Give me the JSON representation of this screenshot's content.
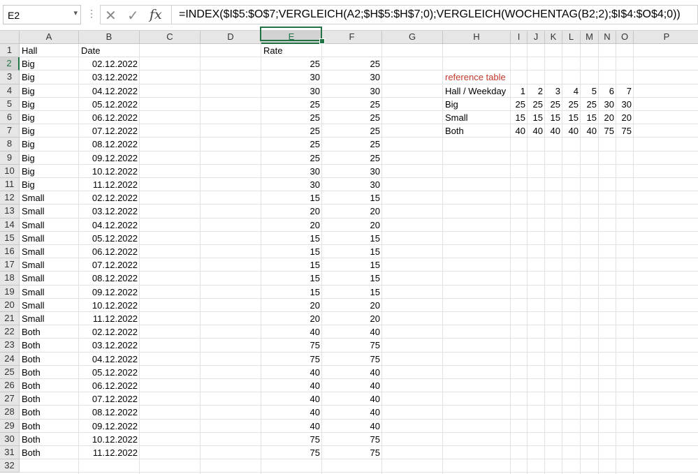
{
  "name_box": {
    "value": "E2"
  },
  "formula_bar": {
    "cancel_icon": "close-icon",
    "enter_icon": "check-icon",
    "fx_label": "fx",
    "formula": "=INDEX($I$5:$O$7;VERGLEICH(A2;$H$5:$H$7;0);VERGLEICH(WOCHENTAG(B2;2);$I$4:$O$4;0))"
  },
  "columns": [
    "A",
    "B",
    "C",
    "D",
    "E",
    "F",
    "G",
    "H",
    "I",
    "J",
    "K",
    "L",
    "M",
    "N",
    "O",
    "P"
  ],
  "active_column": "E",
  "active_row": 2,
  "row_numbers": [
    1,
    2,
    3,
    4,
    5,
    6,
    7,
    8,
    9,
    10,
    11,
    12,
    13,
    14,
    15,
    16,
    17,
    18,
    19,
    20,
    21,
    22,
    23,
    24,
    25,
    26,
    27,
    28,
    29,
    30,
    31,
    32
  ],
  "headers": {
    "A1": "Hall",
    "B1": "Date",
    "E1": "Rate"
  },
  "data_rows": [
    {
      "hall": "Big",
      "date": "02.12.2022",
      "rate": "25",
      "f": "25"
    },
    {
      "hall": "Big",
      "date": "03.12.2022",
      "rate": "30",
      "f": "30"
    },
    {
      "hall": "Big",
      "date": "04.12.2022",
      "rate": "30",
      "f": "30"
    },
    {
      "hall": "Big",
      "date": "05.12.2022",
      "rate": "25",
      "f": "25"
    },
    {
      "hall": "Big",
      "date": "06.12.2022",
      "rate": "25",
      "f": "25"
    },
    {
      "hall": "Big",
      "date": "07.12.2022",
      "rate": "25",
      "f": "25"
    },
    {
      "hall": "Big",
      "date": "08.12.2022",
      "rate": "25",
      "f": "25"
    },
    {
      "hall": "Big",
      "date": "09.12.2022",
      "rate": "25",
      "f": "25"
    },
    {
      "hall": "Big",
      "date": "10.12.2022",
      "rate": "30",
      "f": "30"
    },
    {
      "hall": "Big",
      "date": "11.12.2022",
      "rate": "30",
      "f": "30"
    },
    {
      "hall": "Small",
      "date": "02.12.2022",
      "rate": "15",
      "f": "15"
    },
    {
      "hall": "Small",
      "date": "03.12.2022",
      "rate": "20",
      "f": "20"
    },
    {
      "hall": "Small",
      "date": "04.12.2022",
      "rate": "20",
      "f": "20"
    },
    {
      "hall": "Small",
      "date": "05.12.2022",
      "rate": "15",
      "f": "15"
    },
    {
      "hall": "Small",
      "date": "06.12.2022",
      "rate": "15",
      "f": "15"
    },
    {
      "hall": "Small",
      "date": "07.12.2022",
      "rate": "15",
      "f": "15"
    },
    {
      "hall": "Small",
      "date": "08.12.2022",
      "rate": "15",
      "f": "15"
    },
    {
      "hall": "Small",
      "date": "09.12.2022",
      "rate": "15",
      "f": "15"
    },
    {
      "hall": "Small",
      "date": "10.12.2022",
      "rate": "20",
      "f": "20"
    },
    {
      "hall": "Small",
      "date": "11.12.2022",
      "rate": "20",
      "f": "20"
    },
    {
      "hall": "Both",
      "date": "02.12.2022",
      "rate": "40",
      "f": "40"
    },
    {
      "hall": "Both",
      "date": "03.12.2022",
      "rate": "75",
      "f": "75"
    },
    {
      "hall": "Both",
      "date": "04.12.2022",
      "rate": "75",
      "f": "75"
    },
    {
      "hall": "Both",
      "date": "05.12.2022",
      "rate": "40",
      "f": "40"
    },
    {
      "hall": "Both",
      "date": "06.12.2022",
      "rate": "40",
      "f": "40"
    },
    {
      "hall": "Both",
      "date": "07.12.2022",
      "rate": "40",
      "f": "40"
    },
    {
      "hall": "Both",
      "date": "08.12.2022",
      "rate": "40",
      "f": "40"
    },
    {
      "hall": "Both",
      "date": "09.12.2022",
      "rate": "40",
      "f": "40"
    },
    {
      "hall": "Both",
      "date": "10.12.2022",
      "rate": "75",
      "f": "75"
    },
    {
      "hall": "Both",
      "date": "11.12.2022",
      "rate": "75",
      "f": "75"
    }
  ],
  "reference_table": {
    "title": "reference table",
    "title_color": "#c0392b",
    "header_label": "Hall / Weekday",
    "weekdays": [
      "1",
      "2",
      "3",
      "4",
      "5",
      "6",
      "7"
    ],
    "rows": [
      {
        "label": "Big",
        "values": [
          "25",
          "25",
          "25",
          "25",
          "25",
          "30",
          "30"
        ]
      },
      {
        "label": "Small",
        "values": [
          "15",
          "15",
          "15",
          "15",
          "15",
          "20",
          "20"
        ]
      },
      {
        "label": "Both",
        "values": [
          "40",
          "40",
          "40",
          "40",
          "40",
          "75",
          "75"
        ]
      }
    ]
  },
  "accent_color": "#217346"
}
